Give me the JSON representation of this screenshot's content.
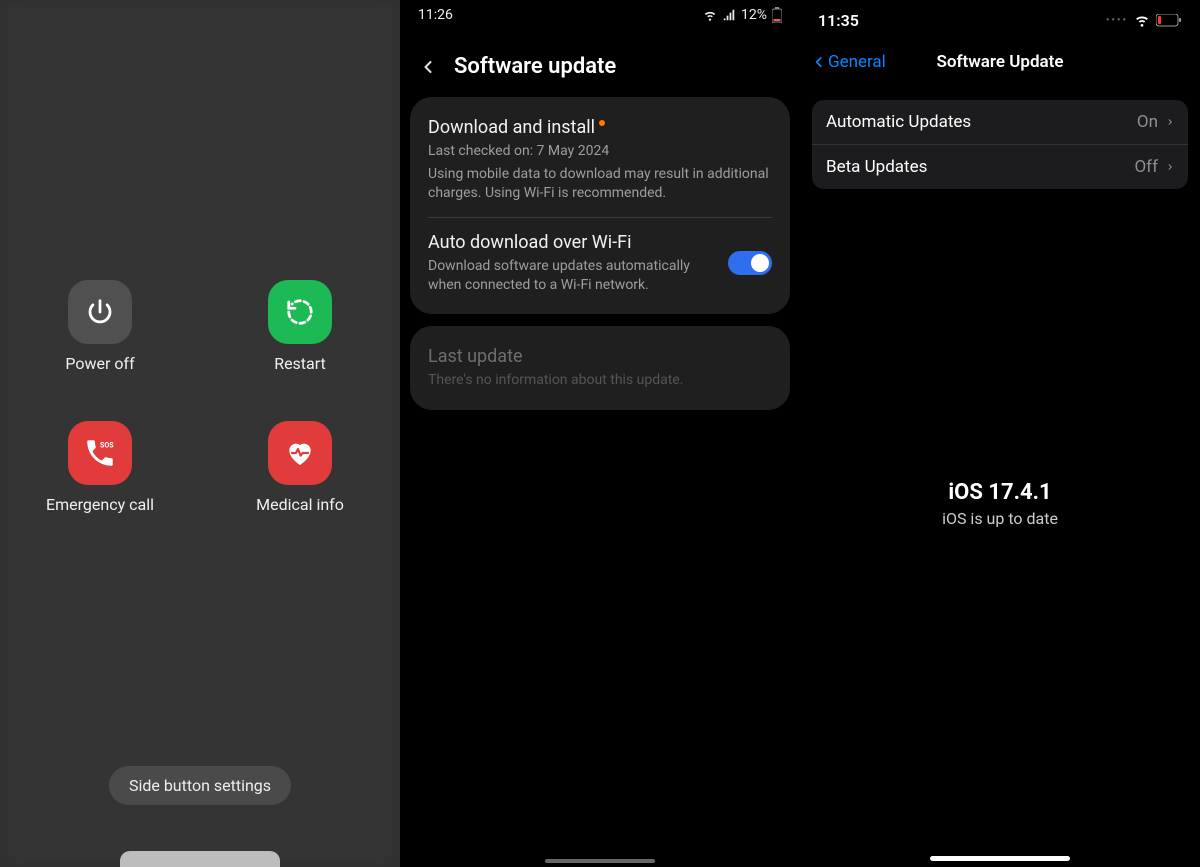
{
  "panel1": {
    "items": [
      {
        "label": "Power off"
      },
      {
        "label": "Restart"
      },
      {
        "label": "Emergency call"
      },
      {
        "label": "Medical info"
      }
    ],
    "side_button": "Side button settings"
  },
  "panel2": {
    "status": {
      "time": "11:26",
      "battery": "12%"
    },
    "title": "Software update",
    "download": {
      "title": "Download and install",
      "sub1": "Last checked on: 7 May 2024",
      "sub2": "Using mobile data to download may result in additional charges. Using Wi-Fi is recommended."
    },
    "auto": {
      "title": "Auto download over Wi-Fi",
      "sub": "Download software updates automatically when connected to a Wi-Fi network."
    },
    "last": {
      "title": "Last update",
      "sub": "There's no information about this update."
    }
  },
  "panel3": {
    "status": {
      "time": "11:35"
    },
    "nav": {
      "back": "General",
      "title": "Software Update"
    },
    "rows": {
      "auto": {
        "label": "Automatic Updates",
        "value": "On"
      },
      "beta": {
        "label": "Beta Updates",
        "value": "Off"
      }
    },
    "center": {
      "version": "iOS 17.4.1",
      "sub": "iOS is up to date"
    }
  }
}
